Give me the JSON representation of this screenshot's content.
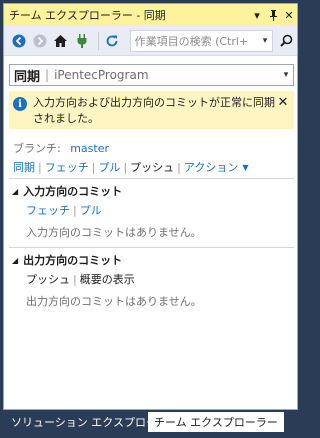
{
  "window": {
    "title": "チーム エクスプローラー - 同期",
    "pin_glyph": "▾",
    "pushpin_glyph": "ᛘ",
    "close_glyph": "✕"
  },
  "toolbar": {
    "search_placeholder": "作業項目の検索 (Ctrl+",
    "search_dropdown": "▾",
    "search_glyph": "⚲"
  },
  "page_selector": {
    "page": "同期",
    "separator": "|",
    "project": "iPentecProgram",
    "arrow": "▾"
  },
  "info_bar": {
    "icon": "i",
    "message": "入力方向および出力方向のコミットが正常に同期されました。",
    "close": "✕"
  },
  "branch": {
    "label": "ブランチ:",
    "name": "master"
  },
  "actions": {
    "sync": "同期",
    "fetch": "フェッチ",
    "pull": "プル",
    "push": "プッシュ",
    "action": "アクション",
    "separator": "|",
    "caret": "▼"
  },
  "incoming": {
    "heading": "入力方向のコミット",
    "triangle": "◢",
    "fetch": "フェッチ",
    "pull": "プル",
    "separator": "|",
    "empty": "入力方向のコミットはありません。"
  },
  "outgoing": {
    "heading": "出力方向のコミット",
    "triangle": "◢",
    "push": "プッシュ",
    "overview": "概要の表示",
    "separator": "|",
    "empty": "出力方向のコミットはありません。"
  },
  "tabs": {
    "solution_explorer": "ソリューション エクスプローラー",
    "team_explorer": "チーム エクスプローラー"
  },
  "colors": {
    "title_bar": "#fff29d",
    "accent_blue": "#1c6fbf",
    "info_background": "#fff5c2",
    "frame_background": "#2b3c57"
  }
}
